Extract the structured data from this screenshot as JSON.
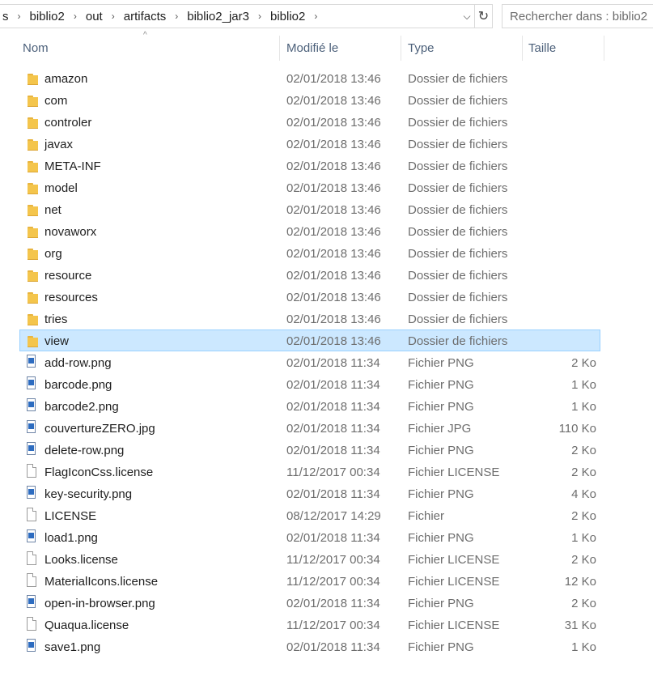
{
  "address": {
    "crumbs": [
      "s",
      "biblio2",
      "out",
      "artifacts",
      "biblio2_jar3",
      "biblio2"
    ],
    "dropdown_icon": "chevron-down-icon",
    "refresh_icon": "refresh-icon"
  },
  "search": {
    "placeholder": "Rechercher dans : biblio2"
  },
  "columns": {
    "name": "Nom",
    "date": "Modifié le",
    "type": "Type",
    "size": "Taille"
  },
  "files": [
    {
      "name": "amazon",
      "date": "02/01/2018 13:46",
      "type": "Dossier de fichiers",
      "size": "",
      "icon": "folder"
    },
    {
      "name": "com",
      "date": "02/01/2018 13:46",
      "type": "Dossier de fichiers",
      "size": "",
      "icon": "folder"
    },
    {
      "name": "controler",
      "date": "02/01/2018 13:46",
      "type": "Dossier de fichiers",
      "size": "",
      "icon": "folder"
    },
    {
      "name": "javax",
      "date": "02/01/2018 13:46",
      "type": "Dossier de fichiers",
      "size": "",
      "icon": "folder"
    },
    {
      "name": "META-INF",
      "date": "02/01/2018 13:46",
      "type": "Dossier de fichiers",
      "size": "",
      "icon": "folder"
    },
    {
      "name": "model",
      "date": "02/01/2018 13:46",
      "type": "Dossier de fichiers",
      "size": "",
      "icon": "folder"
    },
    {
      "name": "net",
      "date": "02/01/2018 13:46",
      "type": "Dossier de fichiers",
      "size": "",
      "icon": "folder"
    },
    {
      "name": "novaworx",
      "date": "02/01/2018 13:46",
      "type": "Dossier de fichiers",
      "size": "",
      "icon": "folder"
    },
    {
      "name": "org",
      "date": "02/01/2018 13:46",
      "type": "Dossier de fichiers",
      "size": "",
      "icon": "folder"
    },
    {
      "name": "resource",
      "date": "02/01/2018 13:46",
      "type": "Dossier de fichiers",
      "size": "",
      "icon": "folder"
    },
    {
      "name": "resources",
      "date": "02/01/2018 13:46",
      "type": "Dossier de fichiers",
      "size": "",
      "icon": "folder"
    },
    {
      "name": "tries",
      "date": "02/01/2018 13:46",
      "type": "Dossier de fichiers",
      "size": "",
      "icon": "folder"
    },
    {
      "name": "view",
      "date": "02/01/2018 13:46",
      "type": "Dossier de fichiers",
      "size": "",
      "icon": "folder",
      "selected": true
    },
    {
      "name": "add-row.png",
      "date": "02/01/2018 11:34",
      "type": "Fichier PNG",
      "size": "2 Ko",
      "icon": "image"
    },
    {
      "name": "barcode.png",
      "date": "02/01/2018 11:34",
      "type": "Fichier PNG",
      "size": "1 Ko",
      "icon": "image"
    },
    {
      "name": "barcode2.png",
      "date": "02/01/2018 11:34",
      "type": "Fichier PNG",
      "size": "1 Ko",
      "icon": "image"
    },
    {
      "name": "couvertureZERO.jpg",
      "date": "02/01/2018 11:34",
      "type": "Fichier JPG",
      "size": "110 Ko",
      "icon": "image"
    },
    {
      "name": "delete-row.png",
      "date": "02/01/2018 11:34",
      "type": "Fichier PNG",
      "size": "2 Ko",
      "icon": "image"
    },
    {
      "name": "FlagIconCss.license",
      "date": "11/12/2017 00:34",
      "type": "Fichier LICENSE",
      "size": "2 Ko",
      "icon": "document"
    },
    {
      "name": "key-security.png",
      "date": "02/01/2018 11:34",
      "type": "Fichier PNG",
      "size": "4 Ko",
      "icon": "image"
    },
    {
      "name": "LICENSE",
      "date": "08/12/2017 14:29",
      "type": "Fichier",
      "size": "2 Ko",
      "icon": "document"
    },
    {
      "name": "load1.png",
      "date": "02/01/2018 11:34",
      "type": "Fichier PNG",
      "size": "1 Ko",
      "icon": "image"
    },
    {
      "name": "Looks.license",
      "date": "11/12/2017 00:34",
      "type": "Fichier LICENSE",
      "size": "2 Ko",
      "icon": "document"
    },
    {
      "name": "MaterialIcons.license",
      "date": "11/12/2017 00:34",
      "type": "Fichier LICENSE",
      "size": "12 Ko",
      "icon": "document"
    },
    {
      "name": "open-in-browser.png",
      "date": "02/01/2018 11:34",
      "type": "Fichier PNG",
      "size": "2 Ko",
      "icon": "image"
    },
    {
      "name": "Quaqua.license",
      "date": "11/12/2017 00:34",
      "type": "Fichier LICENSE",
      "size": "31 Ko",
      "icon": "document"
    },
    {
      "name": "save1.png",
      "date": "02/01/2018 11:34",
      "type": "Fichier PNG",
      "size": "1 Ko",
      "icon": "image"
    }
  ]
}
